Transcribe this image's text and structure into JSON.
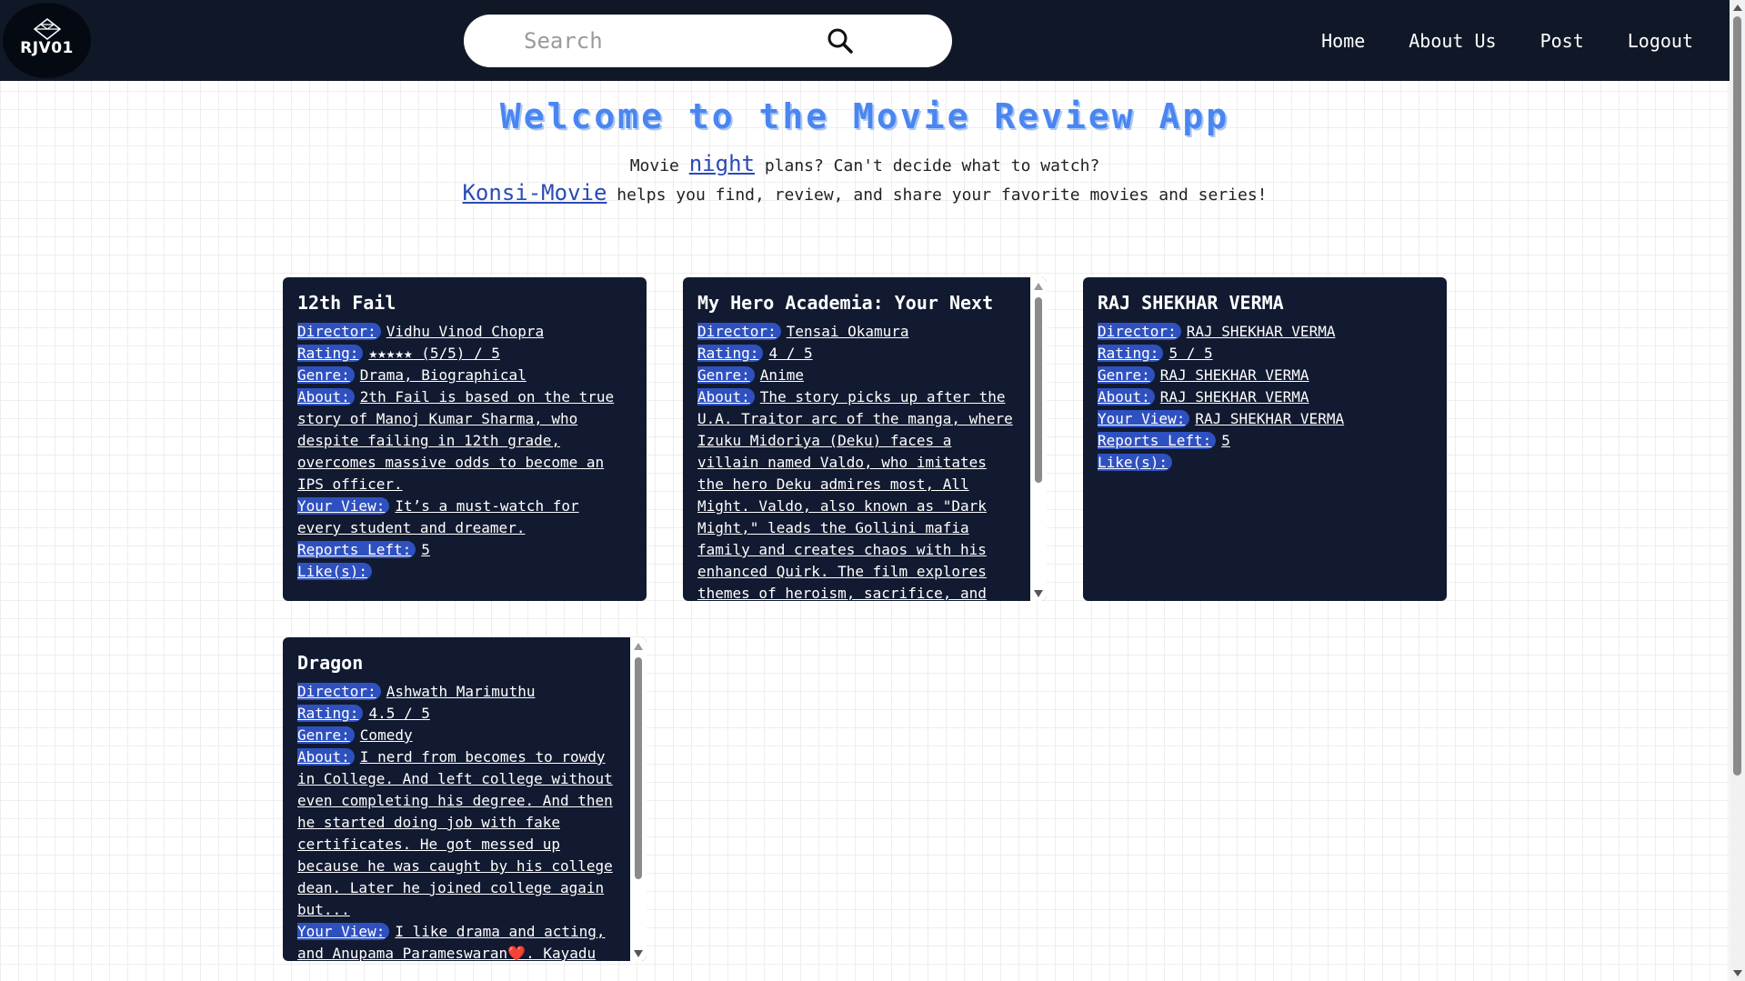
{
  "navbar": {
    "logo_text": "RJV01",
    "search_placeholder": "Search",
    "links": [
      "Home",
      "About Us",
      "Post",
      "Logout"
    ]
  },
  "hero": {
    "title": "Welcome to the Movie Review App",
    "line1_prefix": "Movie ",
    "line1_link": "night",
    "line1_suffix": " plans? Can't decide what to watch?",
    "line2_link": "Konsi-Movie",
    "line2_suffix": " helps you find, review, and share your favorite movies and series!"
  },
  "labels": {
    "director": "Director:",
    "rating": "Rating:",
    "genre": "Genre:",
    "about": "About:",
    "your_view": "Your View:",
    "reports_left": "Reports Left:",
    "likes": "Like(s):"
  },
  "cards": [
    {
      "title": "12th Fail",
      "director": "Vidhu Vinod Chopra",
      "rating": "★★★★★ (5/5) / 5",
      "genre": "Drama, Biographical",
      "about": "2th Fail is based on the true story of Manoj Kumar Sharma, who despite failing in 12th grade, overcomes massive odds to become an IPS officer.",
      "your_view": "It’s a must-watch for every student and dreamer.",
      "reports_left": "5",
      "likes": ""
    },
    {
      "title": "My Hero Academia: Your Next",
      "director": "Tensai Okamura",
      "rating": "4 / 5",
      "genre": "Anime",
      "about": "The story picks up after the U.A. Traitor arc of the manga, where Izuku Midoriya (Deku) faces a villain named Valdo, who imitates the hero Deku admires most, All Might. Valdo, also known as \"Dark Might,\" leads the Gollini mafia family and creates chaos with his enhanced Quirk. The film explores themes of heroism, sacrifice, and",
      "your_view": "",
      "reports_left": "",
      "likes": ""
    },
    {
      "title": "RAJ SHEKHAR VERMA",
      "director": "RAJ SHEKHAR VERMA",
      "rating": "5 / 5",
      "genre": "RAJ SHEKHAR VERMA",
      "about": "RAJ SHEKHAR VERMA",
      "your_view": "RAJ SHEKHAR VERMA",
      "reports_left": "5",
      "likes": ""
    },
    {
      "title": "Dragon",
      "director": "Ashwath Marimuthu",
      "rating": "4.5 / 5",
      "genre": "Comedy",
      "about": "I nerd from becomes to rowdy in College. And left college without even completing his degree. And then he started doing job with fake certificates. He got messed up because he was caught by his college dean. Later he joined college again but...",
      "your_view": "I like drama and acting, and Anupama Parameswaran❤️. Kayadu",
      "reports_left": "",
      "likes": ""
    }
  ],
  "colors": {
    "navbar_bg": "#101828",
    "card_bg": "#111a30",
    "label_highlight": "#2f51bf",
    "title_blue": "#4a86f0"
  },
  "icons": {
    "search": "search-icon",
    "logo": "diamond-logo-icon"
  }
}
